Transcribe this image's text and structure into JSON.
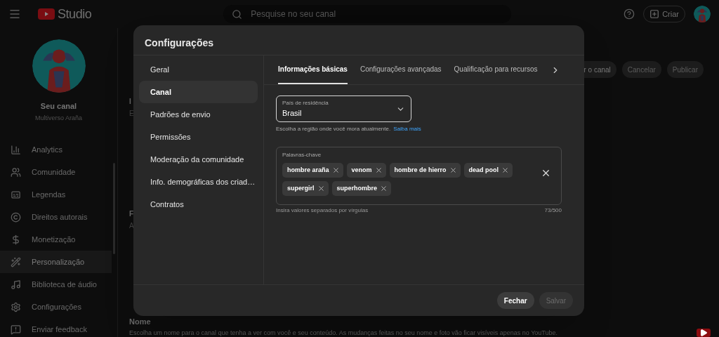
{
  "header": {
    "logo_text": "Studio",
    "search": {
      "placeholder": "Pesquise no seu canal"
    },
    "create_button": "Criar"
  },
  "sidebar": {
    "channel_title": "Seu canal",
    "channel_name": "Multiverso Araña",
    "items": [
      {
        "label": "Analytics",
        "selected": false
      },
      {
        "label": "Comunidade",
        "selected": false
      },
      {
        "label": "Legendas",
        "selected": false
      },
      {
        "label": "Direitos autorais",
        "selected": false
      },
      {
        "label": "Monetização",
        "selected": false
      },
      {
        "label": "Personalização",
        "selected": true
      },
      {
        "label": "Biblioteca de áudio",
        "selected": false
      }
    ],
    "bottom_items": [
      {
        "label": "Configurações"
      },
      {
        "label": "Enviar feedback"
      }
    ]
  },
  "page": {
    "header_buttons": [
      "r o canal",
      "Cancelar",
      "Publicar"
    ],
    "fragments": [
      "I",
      "E",
      "F",
      "A"
    ],
    "name_section": {
      "title": "Nome",
      "description": "Escolha um nome para o canal que tenha a ver com você e seu conteúdo. As mudanças feitas no seu nome e foto vão ficar visíveis apenas no YouTube."
    }
  },
  "dialog": {
    "title": "Configurações",
    "nav": [
      {
        "label": "Geral",
        "selected": false
      },
      {
        "label": "Canal",
        "selected": true
      },
      {
        "label": "Padrões de envio",
        "selected": false
      },
      {
        "label": "Permissões",
        "selected": false
      },
      {
        "label": "Moderação da comunidade",
        "selected": false
      },
      {
        "label": "Info. demográficas dos criad…",
        "selected": false
      },
      {
        "label": "Contratos",
        "selected": false
      }
    ],
    "tabs": [
      {
        "label": "Informações básicas",
        "selected": true
      },
      {
        "label": "Configurações avançadas",
        "selected": false
      },
      {
        "label": "Qualificação para recursos",
        "selected": false
      }
    ],
    "country": {
      "label": "País de residência",
      "value": "Brasil",
      "help": "Escolha a região onde você mora atualmente.",
      "link": "Saiba mais"
    },
    "keywords": {
      "label": "Palavras-chave",
      "chips": [
        "hombre araña",
        "venom",
        "hombre de hierro",
        "dead pool",
        "supergirl",
        "superhombre"
      ],
      "hint": "Insira valores separados por vírgulas",
      "counter": "73/500"
    },
    "buttons": [
      {
        "label": "Fechar",
        "disabled": false
      },
      {
        "label": "Salvar",
        "disabled": true
      }
    ]
  }
}
